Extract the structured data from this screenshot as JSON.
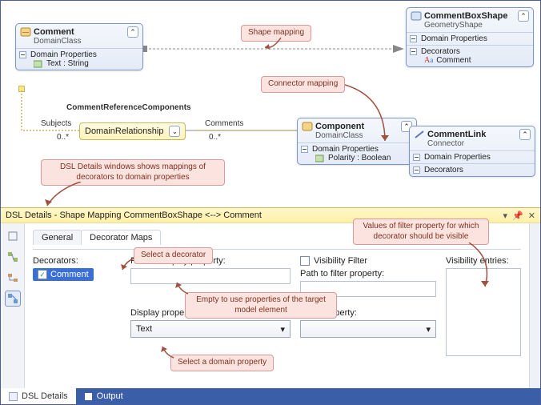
{
  "diagram": {
    "comment": {
      "title": "Comment",
      "sub": "DomainClass",
      "sec": "Domain Properties",
      "prop": "Text : String"
    },
    "component": {
      "title": "Component",
      "sub": "DomainClass",
      "sec": "Domain Properties",
      "prop": "Polarity : Boolean"
    },
    "shape": {
      "title": "CommentBoxShape",
      "sub": "GeometryShape",
      "sec1": "Domain Properties",
      "sec2": "Decorators",
      "dec": "Comment"
    },
    "link": {
      "title": "CommentLink",
      "sub": "Connector",
      "sec1": "Domain Properties",
      "sec2": "Decorators"
    },
    "rel": {
      "name": "CommentReferenceComponents",
      "label": "DomainRelationship",
      "role1": "Subjects",
      "mult1": "0..*",
      "role2": "Comments",
      "mult2": "0..*"
    }
  },
  "callouts": {
    "shape_mapping": "Shape mapping",
    "connector_mapping": "Connector mapping",
    "dsl_details": "DSL Details windows shows mappings of decorators to domain properties",
    "sel_decorator": "Select a decorator",
    "empty_path": "Empty to use properties of the target model element",
    "sel_domain_prop": "Select a domain property",
    "vis_entries": "Values of filter property for which decorator should be visible"
  },
  "details": {
    "title": "DSL Details - Shape Mapping CommentBoxShape <--> Comment",
    "tabs": {
      "general": "General",
      "maps": "Decorator Maps"
    },
    "decorators_label": "Decorators:",
    "dec_item": "Comment",
    "path_display": "Path to display property:",
    "display_prop": "Display property:",
    "display_val": "Text",
    "vis_filter": "Visibility Filter",
    "path_filter": "Path to filter property:",
    "filter_prop": "Filter property:",
    "vis_entries": "Visibility entries:"
  },
  "bottom": {
    "dsl": "DSL Details",
    "out": "Output"
  }
}
